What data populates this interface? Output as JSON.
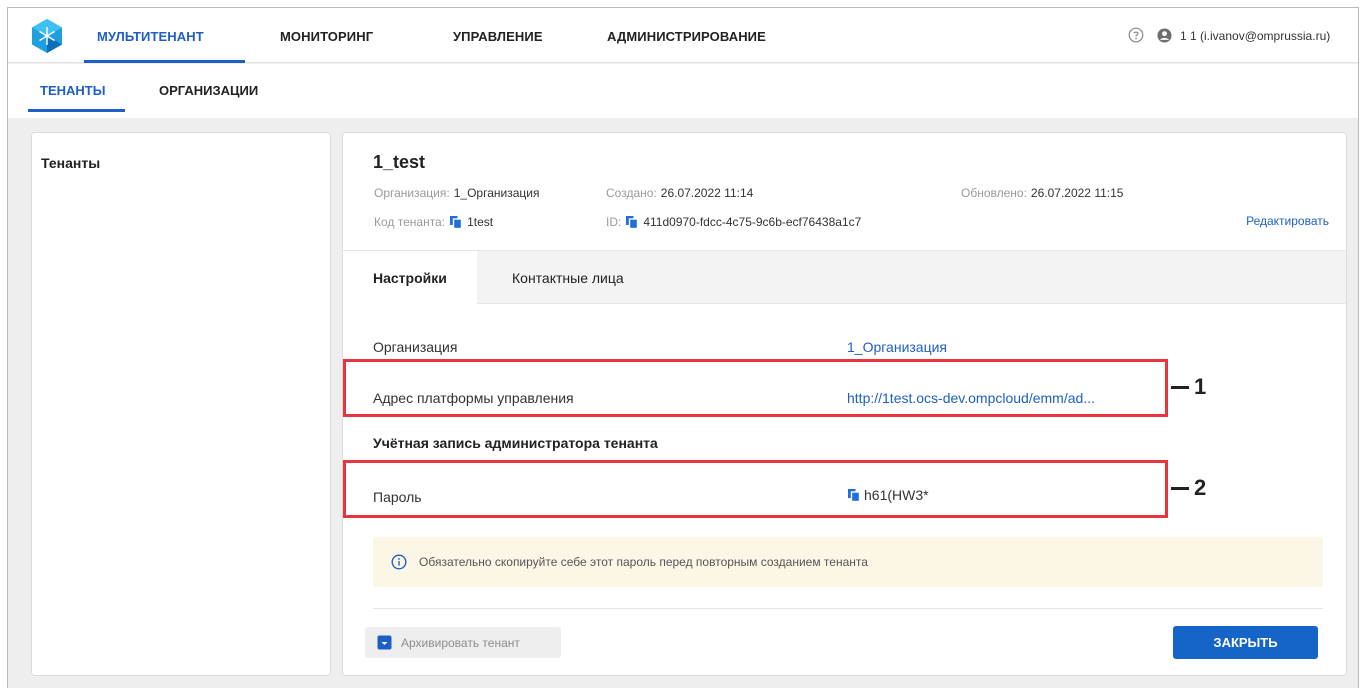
{
  "topbar": {
    "nav": [
      "МУЛЬТИТЕНАНТ",
      "МОНИТОРИНГ",
      "УПРАВЛЕНИЕ",
      "АДМИНИСТРИРОВАНИЕ"
    ],
    "user": "1 1 (i.ivanov@omprussia.ru)"
  },
  "subnav": [
    "ТЕНАНТЫ",
    "ОРГАНИЗАЦИИ"
  ],
  "left_panel": {
    "title": "Тенанты"
  },
  "tenant": {
    "name": "1_test",
    "org_label": "Организация:",
    "org_value": "1_Организация",
    "created_label": "Создано:",
    "created_value": "26.07.2022 11:14",
    "updated_label": "Обновлено:",
    "updated_value": "26.07.2022 11:15",
    "code_label": "Код тенанта:",
    "code_value": "1test",
    "id_label": "ID:",
    "id_value": "411d0970-fdcc-4c75-9c6b-ecf76438a1c7",
    "edit": "Редактировать"
  },
  "tabs": [
    "Настройки",
    "Контактные лица"
  ],
  "settings": {
    "org_label": "Организация",
    "org_value": "1_Организация",
    "address_label": "Адрес платформы управления",
    "address_value": "http://1test.ocs-dev.ompcloud/emm/ad...",
    "section_title": "Учётная запись администратора тенанта",
    "password_label": "Пароль",
    "password_value": "h61(HW3*",
    "notice": "Обязательно скопируйте себе этот пароль перед повторным созданием тенанта"
  },
  "buttons": {
    "archive": "Архивировать тенант",
    "close": "ЗАКРЫТЬ"
  },
  "callouts": [
    "1",
    "2"
  ],
  "colors": {
    "accent": "#1e5fc7",
    "highlight": "#e8343c",
    "notice_bg": "#fcf6e6"
  }
}
